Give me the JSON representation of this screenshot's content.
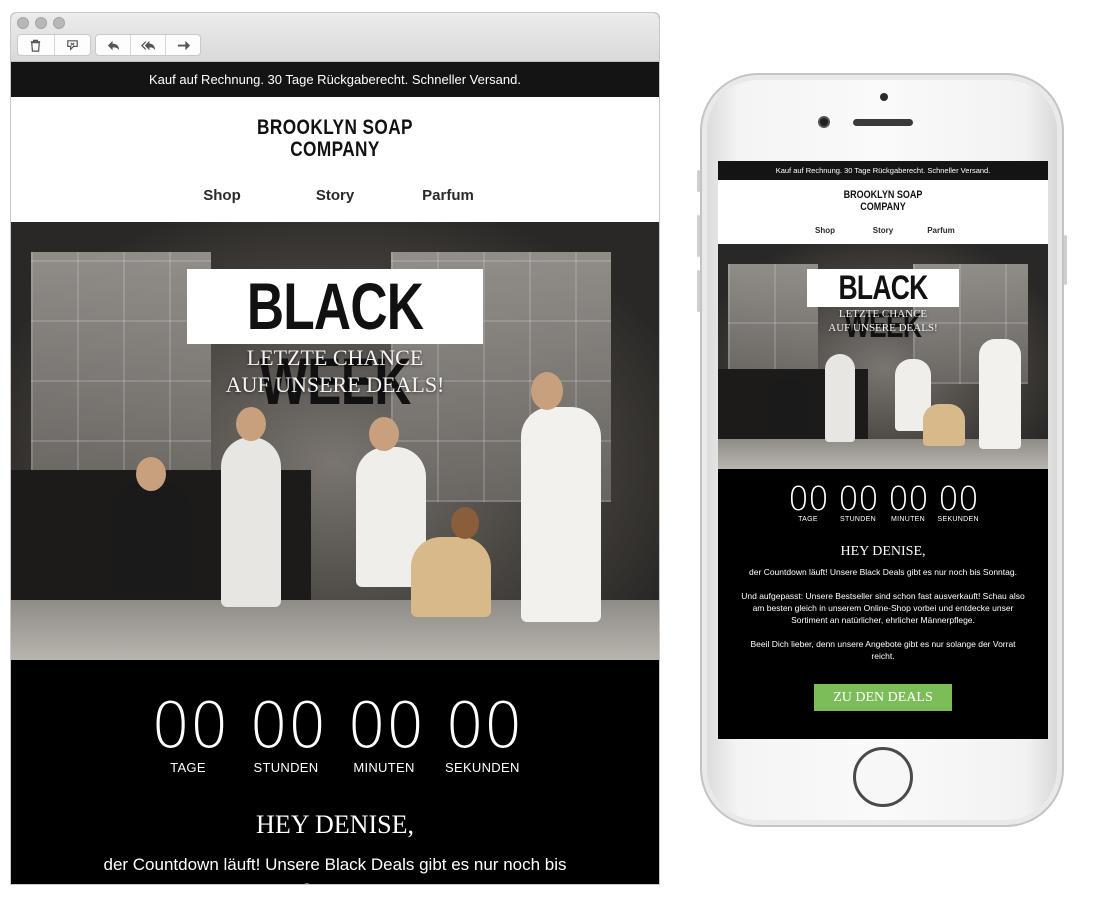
{
  "desktop": {
    "toolbar": {
      "buttons": [
        {
          "icon": "trash-icon"
        },
        {
          "icon": "junk-icon"
        },
        {
          "icon": "reply-icon"
        },
        {
          "icon": "reply-all-icon"
        },
        {
          "icon": "forward-icon"
        }
      ]
    },
    "topbar_text": "Kauf auf Rechnung. 30 Tage Rückgaberecht. Schneller Versand.",
    "logo_line1": "BROOKLYN SOAP",
    "logo_line2": "COMPANY",
    "nav": [
      "Shop",
      "Story",
      "Parfum"
    ],
    "hero": {
      "headline": "BLACK WEEK",
      "sub_line1": "LETZTE CHANCE",
      "sub_line2": "AUF UNSERE DEALS!"
    },
    "countdown": [
      {
        "value": "00",
        "label": "TAGE"
      },
      {
        "value": "00",
        "label": "STUNDEN"
      },
      {
        "value": "00",
        "label": "MINUTEN"
      },
      {
        "value": "00",
        "label": "SEKUNDEN"
      }
    ],
    "greeting": "HEY DENISE,",
    "body_text": "der Countdown läuft! Unsere Black Deals gibt es nur noch bis Sonntag."
  },
  "mobile": {
    "topbar_text": "Kauf auf Rechnung. 30 Tage Rückgaberecht. Schneller Versand.",
    "logo_line1": "BROOKLYN SOAP",
    "logo_line2": "COMPANY",
    "nav": [
      "Shop",
      "Story",
      "Parfum"
    ],
    "hero": {
      "headline": "BLACK WEEK",
      "sub_line1": "LETZTE CHANCE",
      "sub_line2": "AUF UNSERE DEALS!"
    },
    "countdown": [
      {
        "value": "00",
        "label": "TAGE"
      },
      {
        "value": "00",
        "label": "STUNDEN"
      },
      {
        "value": "00",
        "label": "MINUTEN"
      },
      {
        "value": "00",
        "label": "SEKUNDEN"
      }
    ],
    "greeting": "HEY DENISE,",
    "paragraph1": "der Countdown läuft! Unsere Black Deals gibt es nur noch bis Sonntag.",
    "paragraph2": "Und aufgepasst: Unsere Bestseller sind schon fast ausverkauft! Schau also am besten gleich in unserem Online-Shop vorbei und entdecke unser Sortiment an natürlicher, ehrlicher Männerpflege.",
    "paragraph3": "Beeil Dich lieber, denn unsere Angebote gibt es nur solange der Vorrat reicht.",
    "cta_label": "ZU DEN DEALS"
  },
  "colors": {
    "cta_green": "#7cbd5a",
    "topbar_black": "#141414",
    "body_black": "#000000"
  }
}
